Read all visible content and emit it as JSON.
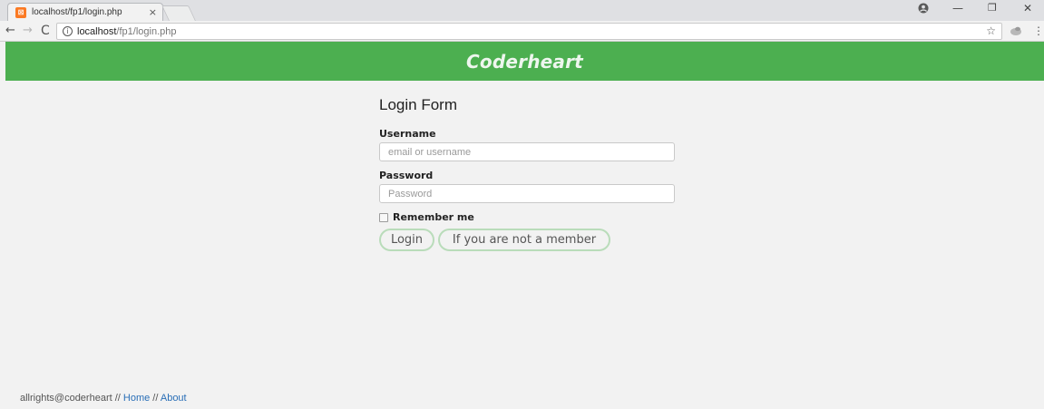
{
  "browser": {
    "tab_title": "localhost/fp1/login.php",
    "tab_favicon": "xampp-favicon-icon",
    "tab_close": "×",
    "url_host": "localhost",
    "url_path": "/fp1/login.php",
    "back_glyph": "←",
    "forward_glyph": "→",
    "reload_glyph": "C",
    "info_glyph": "i",
    "star_glyph": "☆",
    "menu_glyph": "⋮",
    "min_glyph": "—",
    "max_glyph": "❐",
    "close_glyph": "✕"
  },
  "header": {
    "logo": "Coderheart",
    "bg_color": "#4caf50"
  },
  "form": {
    "title": "Login Form",
    "username_label": "Username",
    "username_value": "",
    "username_placeholder": "email or username",
    "password_label": "Password",
    "password_value": "",
    "password_placeholder": "Password",
    "remember_label": "Remember me",
    "remember_checked": false,
    "login_button": "Login",
    "member_button": "If you are not a member"
  },
  "footer": {
    "copyright": "allrights@coderheart // ",
    "home_link": "Home",
    "separator": " // ",
    "about_link": "About"
  }
}
